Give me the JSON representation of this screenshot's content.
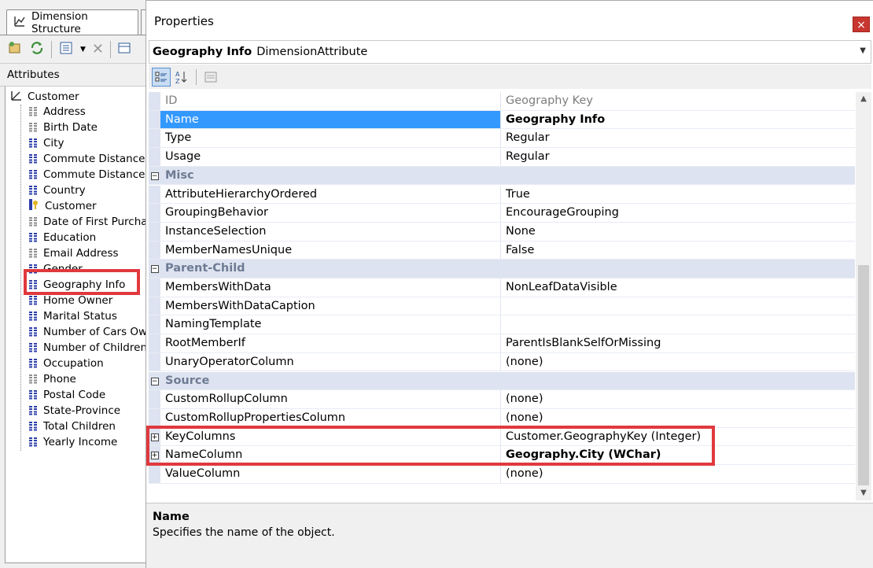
{
  "left_panel": {
    "tab_label": "Dimension Structure",
    "attributes_header": "Attributes",
    "root_label": "Customer",
    "items": [
      {
        "label": "Address",
        "icon": "gray"
      },
      {
        "label": "Birth Date",
        "icon": "gray"
      },
      {
        "label": "City",
        "icon": "blue"
      },
      {
        "label": "Commute Distance",
        "icon": "blue"
      },
      {
        "label": "Commute Distance Sc",
        "icon": "blue"
      },
      {
        "label": "Country",
        "icon": "blue"
      },
      {
        "label": "Customer",
        "icon": "key"
      },
      {
        "label": "Date of First Purchas",
        "icon": "gray"
      },
      {
        "label": "Education",
        "icon": "blue"
      },
      {
        "label": "Email Address",
        "icon": "gray"
      },
      {
        "label": "Gender",
        "icon": "blue"
      },
      {
        "label": "Geography Info",
        "icon": "blue"
      },
      {
        "label": "Home Owner",
        "icon": "blue"
      },
      {
        "label": "Marital Status",
        "icon": "blue"
      },
      {
        "label": "Number of Cars Own",
        "icon": "blue"
      },
      {
        "label": "Number of Children A",
        "icon": "blue"
      },
      {
        "label": "Occupation",
        "icon": "blue"
      },
      {
        "label": "Phone",
        "icon": "gray"
      },
      {
        "label": "Postal Code",
        "icon": "blue"
      },
      {
        "label": "State-Province",
        "icon": "blue"
      },
      {
        "label": "Total Children",
        "icon": "blue"
      },
      {
        "label": "Yearly Income",
        "icon": "blue"
      }
    ]
  },
  "properties": {
    "window_title": "Properties",
    "close_label": "×",
    "object_name": "Geography Info",
    "object_type": "DimensionAttribute",
    "rows": [
      {
        "kind": "prop",
        "name": "ID",
        "value": "Geography Key",
        "dim": true
      },
      {
        "kind": "prop",
        "name": "Name",
        "value": "Geography Info",
        "selected": true,
        "bold": true
      },
      {
        "kind": "prop",
        "name": "Type",
        "value": "Regular"
      },
      {
        "kind": "prop",
        "name": "Usage",
        "value": "Regular"
      },
      {
        "kind": "cat",
        "name": "Misc"
      },
      {
        "kind": "prop",
        "name": "AttributeHierarchyOrdered",
        "value": "True"
      },
      {
        "kind": "prop",
        "name": "GroupingBehavior",
        "value": "EncourageGrouping"
      },
      {
        "kind": "prop",
        "name": "InstanceSelection",
        "value": "None"
      },
      {
        "kind": "prop",
        "name": "MemberNamesUnique",
        "value": "False"
      },
      {
        "kind": "cat",
        "name": "Parent-Child"
      },
      {
        "kind": "prop",
        "name": "MembersWithData",
        "value": "NonLeafDataVisible"
      },
      {
        "kind": "prop",
        "name": "MembersWithDataCaption",
        "value": ""
      },
      {
        "kind": "prop",
        "name": "NamingTemplate",
        "value": ""
      },
      {
        "kind": "prop",
        "name": "RootMemberIf",
        "value": "ParentIsBlankSelfOrMissing"
      },
      {
        "kind": "prop",
        "name": "UnaryOperatorColumn",
        "value": "(none)"
      },
      {
        "kind": "cat",
        "name": "Source"
      },
      {
        "kind": "prop",
        "name": "CustomRollupColumn",
        "value": "(none)"
      },
      {
        "kind": "prop",
        "name": "CustomRollupPropertiesColumn",
        "value": "(none)"
      },
      {
        "kind": "prop",
        "name": "KeyColumns",
        "value": "Customer.GeographyKey (Integer)",
        "expandable": true
      },
      {
        "kind": "prop",
        "name": "NameColumn",
        "value": "Geography.City (WChar)",
        "expandable": true,
        "bold": true
      },
      {
        "kind": "prop",
        "name": "ValueColumn",
        "value": "(none)"
      }
    ],
    "description_title": "Name",
    "description_text": "Specifies the name of the object."
  },
  "colors": {
    "selection": "#3399ff",
    "highlight_box": "#e0393e",
    "category_band": "#dde3f0"
  }
}
